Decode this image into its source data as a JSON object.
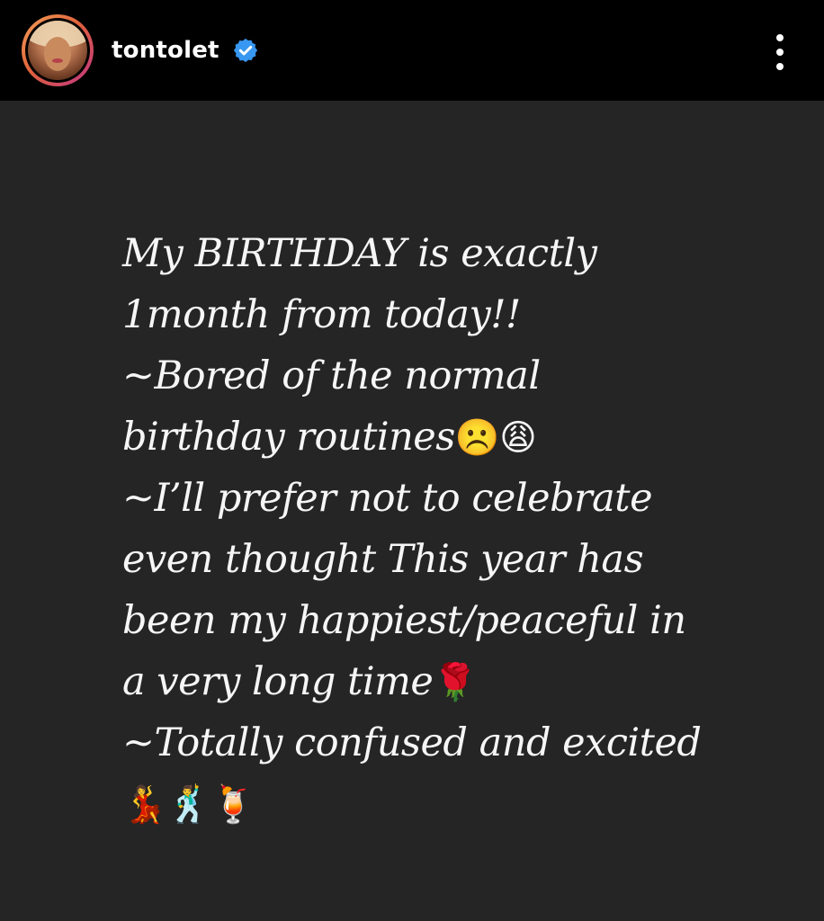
{
  "header": {
    "username": "tontolet",
    "verified": true,
    "menu_icon": "more-vertical-icon"
  },
  "story": {
    "background_color": "#252525",
    "text_color": "#f6f6f6",
    "lines": [
      "My BIRTHDAY is exactly",
      "1month from today!!",
      "~Bored of the normal",
      "birthday routines",
      "~I’ll prefer not to celebrate",
      "even thought This year has",
      "been my happiest/peaceful in",
      "a very long time",
      "~Totally confused and excited"
    ],
    "emojis": {
      "routines": "☹️😩",
      "time": "🌹",
      "excited": "💃🕺🍹"
    }
  },
  "colors": {
    "verified_blue": "#3897f0",
    "header_bg": "#000000"
  }
}
